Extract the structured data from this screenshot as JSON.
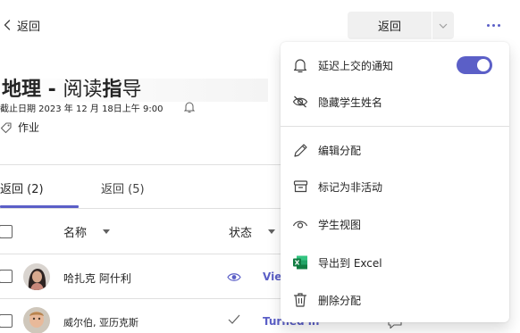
{
  "topbar": {
    "back_label": "返回",
    "split_button_label": "返回"
  },
  "assignment": {
    "title_prefix": "地理 - ",
    "title_mid": "阅读",
    "title_bold2": "指",
    "title_rest": "导",
    "due_text": "截止日期 2023 年 12 月 18日上午 9:00",
    "tag_label": "作业"
  },
  "tabs": [
    {
      "label": "返回 (2)",
      "selected": true
    },
    {
      "label": "返回 (5)",
      "selected": false
    }
  ],
  "table": {
    "columns": {
      "name": "名称",
      "status": "状态"
    },
    "rows": [
      {
        "name": "哈扎克 阿什利",
        "status": "Vie"
      },
      {
        "name": "威尔伯, 亚历克斯",
        "status": "Turned in"
      }
    ]
  },
  "menu": {
    "items": [
      {
        "label": "延迟上交的通知",
        "icon": "bell-icon",
        "toggle_on": true
      },
      {
        "label": "隐藏学生姓名",
        "icon": "eye-off-icon"
      },
      {
        "label": "编辑分配",
        "icon": "pencil-icon"
      },
      {
        "label": "标记为非活动",
        "icon": "archive-icon"
      },
      {
        "label": "学生视图",
        "icon": "eye-icon"
      },
      {
        "label": "导出到 Excel",
        "icon": "excel-icon"
      },
      {
        "label": "删除分配",
        "icon": "trash-icon"
      }
    ]
  },
  "colors": {
    "accent": "#5b5fc7",
    "excel": "#107c41"
  }
}
